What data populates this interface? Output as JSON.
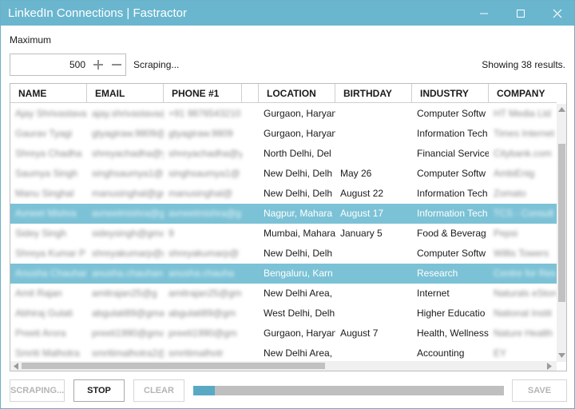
{
  "window": {
    "title": "LinkedIn Connections | Fastractor"
  },
  "controls": {
    "maximum_label": "Maximum",
    "maximum_value": "500",
    "status_text": "Scraping...",
    "results_text": "Showing 38 results."
  },
  "table": {
    "columns": [
      "NAME",
      "EMAIL",
      "PHONE #1",
      "",
      "LOCATION",
      "BIRTHDAY",
      "INDUSTRY",
      "COMPANY"
    ],
    "rows": [
      {
        "name": "Ajay Shrivastava",
        "email": "ajay.shrivastava@g",
        "phone": "+91 9876543210",
        "location": "Gurgaon, Haryan",
        "birthday": "",
        "industry": "Computer Softw",
        "company": "HT Media Ltd",
        "selected": false
      },
      {
        "name": "Gaurav Tyagi",
        "email": "gtyagiraw.9809@",
        "phone": "gtyagiraw.9809",
        "location": "Gurgaon, Haryan",
        "birthday": "",
        "industry": "Information Tech",
        "company": "Times Internet",
        "selected": false
      },
      {
        "name": "Shreya Chadha",
        "email": "shreyachadha@yahoo",
        "phone": "shreyachadha@y",
        "location": "North Delhi, Del",
        "birthday": "",
        "industry": "Financial Service",
        "company": "Citybank.com",
        "selected": false
      },
      {
        "name": "Saumya Singh",
        "email": "singhsaumya1@gm",
        "phone": "singhsaumya1@",
        "location": "New Delhi, Delh",
        "birthday": "May 26",
        "industry": "Computer Softw",
        "company": "AmbiEnig",
        "selected": false
      },
      {
        "name": "Manu Singhal",
        "email": "manusinghal@gma",
        "phone": "manusinghal@",
        "location": "New Delhi, Delh",
        "birthday": "August 22",
        "industry": "Information Tech",
        "company": "Zomato",
        "selected": false
      },
      {
        "name": "Avneet Mishra",
        "email": "avneetmishra@gmai",
        "phone": "avneetmishra@g",
        "location": "Nagpur, Mahara",
        "birthday": "August 17",
        "industry": "Information Tech",
        "company": "TCS - Consult",
        "selected": true
      },
      {
        "name": "Sidey Singh",
        "email": "sideysingh@gmail",
        "phone": "9",
        "location": "Mumbai, Mahara",
        "birthday": "January 5",
        "industry": "Food & Beverag",
        "company": "Pepsi",
        "selected": false
      },
      {
        "name": "Shreya Kumar P",
        "email": "shreyakumarp@gm",
        "phone": "shreyakumarp@",
        "location": "New Delhi, Delh",
        "birthday": "",
        "industry": "Computer Softw",
        "company": "Willis Towers",
        "selected": false
      },
      {
        "name": "Anusha Chauhan",
        "email": "anusha.chauhan@g",
        "phone": "anusha.chauha",
        "location": "Bengaluru, Karn",
        "birthday": "",
        "industry": "Research",
        "company": "Centre for Res",
        "selected": true
      },
      {
        "name": "Amit Rajan",
        "email": "amitrajan25@g",
        "phone": "amitrajan25@gm",
        "location": "New Delhi Area,",
        "birthday": "",
        "industry": "Internet",
        "company": "Naturals eStore",
        "selected": false
      },
      {
        "name": "Abhiraj Gulati",
        "email": "abgulati89@gmail",
        "phone": "abgulati89@gm",
        "location": "West Delhi, Delh",
        "birthday": "",
        "industry": "Higher Educatio",
        "company": "National Instit",
        "selected": false
      },
      {
        "name": "Preeti Arora",
        "email": "preeti1990@gmail",
        "phone": "preeti1990@gm",
        "location": "Gurgaon, Haryan",
        "birthday": "August 7",
        "industry": "Health, Wellness",
        "company": "Nature Health",
        "selected": false
      },
      {
        "name": "Smriti Malhotra",
        "email": "smritimalhotra2@",
        "phone": "smritimalhotr",
        "location": "New Delhi Area,",
        "birthday": "",
        "industry": "Accounting",
        "company": "EY",
        "selected": false
      }
    ]
  },
  "buttons": {
    "scraping": "SCRAPING...",
    "stop": "STOP",
    "clear": "CLEAR",
    "save": "SAVE"
  },
  "progress": {
    "fraction": 0.07
  },
  "colors": {
    "accent": "#6ab6cf",
    "selected_row": "#7cc2d6",
    "progress_fill": "#5aa9c4"
  }
}
